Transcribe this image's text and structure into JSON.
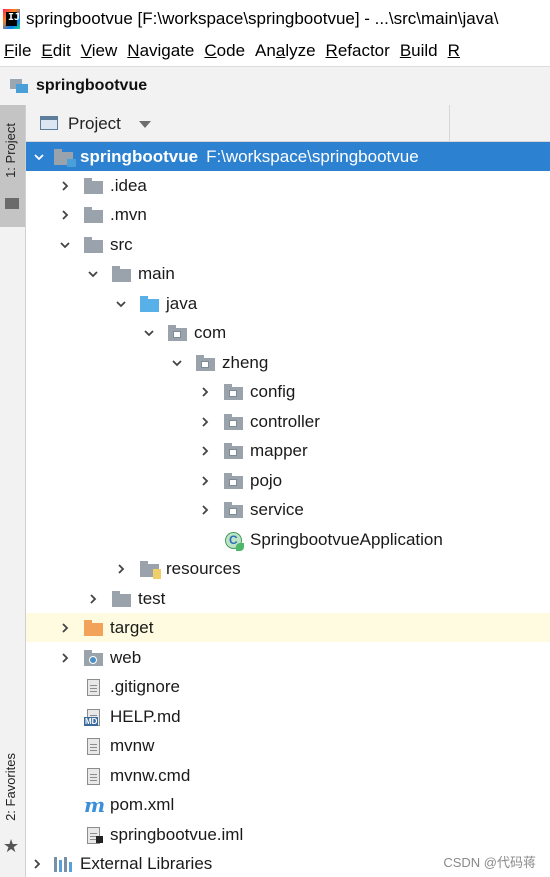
{
  "window": {
    "title": "springbootvue [F:\\workspace\\springbootvue] - ...\\src\\main\\java\\"
  },
  "menu": [
    {
      "mnemonic": "F",
      "rest": "ile"
    },
    {
      "mnemonic": "E",
      "rest": "dit"
    },
    {
      "mnemonic": "V",
      "rest": "iew"
    },
    {
      "mnemonic": "N",
      "rest": "avigate"
    },
    {
      "mnemonic": "C",
      "rest": "ode"
    },
    {
      "mnemonic": "",
      "rest": "Analyze",
      "underline_index": 2
    },
    {
      "mnemonic": "R",
      "rest": "efactor"
    },
    {
      "mnemonic": "B",
      "rest": "uild"
    },
    {
      "mnemonic": "R",
      "rest": ""
    }
  ],
  "navbar": {
    "project_name": "springbootvue"
  },
  "side_tabs": {
    "project": "1: Project",
    "favorites": "2: Favorites"
  },
  "toolbar": {
    "view_label": "Project"
  },
  "tree": {
    "root": {
      "name": "springbootvue",
      "path": "F:\\workspace\\springbootvue"
    },
    "items": [
      {
        "label": "springbootvue"
      },
      {
        "label": ".idea"
      },
      {
        "label": ".mvn"
      },
      {
        "label": "src"
      },
      {
        "label": "main"
      },
      {
        "label": "java"
      },
      {
        "label": "com"
      },
      {
        "label": "zheng"
      },
      {
        "label": "config"
      },
      {
        "label": "controller"
      },
      {
        "label": "mapper"
      },
      {
        "label": "pojo"
      },
      {
        "label": "service"
      },
      {
        "label": "SpringbootvueApplication"
      },
      {
        "label": "resources"
      },
      {
        "label": "test"
      },
      {
        "label": "target"
      },
      {
        "label": "web"
      },
      {
        "label": ".gitignore"
      },
      {
        "label": "HELP.md"
      },
      {
        "label": "mvnw"
      },
      {
        "label": "mvnw.cmd"
      },
      {
        "label": "pom.xml"
      },
      {
        "label": "springbootvue.iml"
      },
      {
        "label": "External Libraries"
      }
    ]
  },
  "colors": {
    "selection": "#2c81d0",
    "excluded_folder": "#f3a359",
    "source_folder": "#58b0e9"
  },
  "watermark": "CSDN @代码蒋"
}
